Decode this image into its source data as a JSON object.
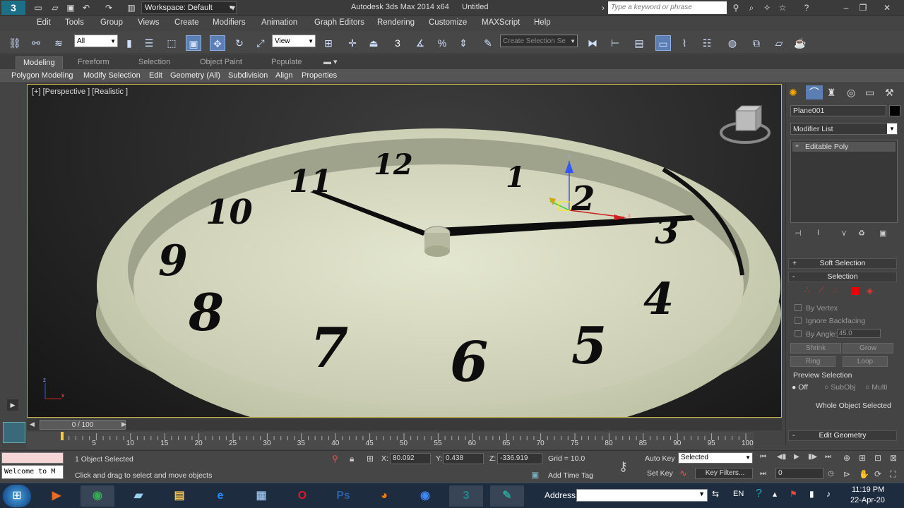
{
  "titlebar": {
    "app_icon_label": "3",
    "workspace": "Workspace: Default",
    "app_name": "Autodesk 3ds Max  2014 x64",
    "doc_name": "Untitled",
    "search_placeholder": "Type a keyword or phrase"
  },
  "menu": [
    "Edit",
    "Tools",
    "Group",
    "Views",
    "Create",
    "Modifiers",
    "Animation",
    "Graph Editors",
    "Rendering",
    "Customize",
    "MAXScript",
    "Help"
  ],
  "toolbar": {
    "selection_filter": "All",
    "ref_coord": "View",
    "named_selection": "Create Selection Se",
    "snap_label": "3"
  },
  "ribbon": {
    "tabs": [
      "Modeling",
      "Freeform",
      "Selection",
      "Object Paint",
      "Populate"
    ],
    "active_tab": "Modeling",
    "sub": [
      "Polygon Modeling",
      "Modify Selection",
      "Edit",
      "Geometry (All)",
      "Subdivision",
      "Align",
      "Properties"
    ]
  },
  "viewport": {
    "label": "[+] [Perspective ] [Realistic ]",
    "clock_numbers": [
      "12",
      "1",
      "2",
      "3",
      "4",
      "5",
      "6",
      "7",
      "8",
      "9",
      "10",
      "11"
    ],
    "gizmo": {
      "x": "x",
      "y": "y",
      "z": "z"
    }
  },
  "command_panel": {
    "object_name": "Plane001",
    "modifier_list": "Modifier List",
    "stack_item": "Editable Poly",
    "soft_selection": "Soft Selection",
    "selection": "Selection",
    "by_vertex": "By Vertex",
    "ignore_backfacing": "Ignore Backfacing",
    "by_angle": "By Angle:",
    "angle_value": "45.0",
    "shrink": "Shrink",
    "grow": "Grow",
    "ring": "Ring",
    "loop": "Loop",
    "preview_selection": "Preview Selection",
    "preview_options": [
      "Off",
      "SubObj",
      "Multi"
    ],
    "whole_object": "Whole Object Selected",
    "edit_geometry": "Edit Geometry",
    "rollout_plus": "+",
    "rollout_minus": "-"
  },
  "timeline": {
    "frame": "0 / 100",
    "ticks": [
      "5",
      "10",
      "15",
      "20",
      "25",
      "30",
      "35",
      "40",
      "45",
      "50",
      "55",
      "60",
      "65",
      "70",
      "75",
      "80",
      "85",
      "90",
      "95",
      "100"
    ]
  },
  "status": {
    "selected": "1 Object Selected",
    "hint": "Click and drag to select and move objects",
    "maxscript": "Welcome to M",
    "x_label": "X:",
    "x": "80.092",
    "y_label": "Y:",
    "y": "0.438",
    "z_label": "Z:",
    "z": "-336.919",
    "grid": "Grid = 10.0",
    "add_time_tag": "Add Time Tag",
    "auto_key": "Auto Key",
    "set_key": "Set Key",
    "key_mode": "Selected",
    "key_filters": "Key Filters...",
    "frame_field": "0"
  },
  "taskbar": {
    "address_label": "Address",
    "lang": "EN",
    "time": "11:19 PM",
    "date": "22-Apr-20",
    "apps": [
      {
        "name": "windows-media-icon",
        "glyph": "▶",
        "color": "#e86d1f"
      },
      {
        "name": "chrome-icon",
        "glyph": "◉",
        "color": "#3aa757"
      },
      {
        "name": "files-icon",
        "glyph": "▰",
        "color": "#9ad0ec"
      },
      {
        "name": "explorer-icon",
        "glyph": "▤",
        "color": "#f0c24a"
      },
      {
        "name": "ie-icon",
        "glyph": "e",
        "color": "#1e90ff"
      },
      {
        "name": "calculator-icon",
        "glyph": "▦",
        "color": "#8fb3d9"
      },
      {
        "name": "opera-icon",
        "glyph": "O",
        "color": "#e0182d"
      },
      {
        "name": "photoshop-icon",
        "glyph": "Ps",
        "color": "#2a5fa8"
      },
      {
        "name": "firefox-icon",
        "glyph": "◕",
        "color": "#ff7a00"
      },
      {
        "name": "chrome2-icon",
        "glyph": "◉",
        "color": "#4285f4"
      },
      {
        "name": "3dsmax-icon",
        "glyph": "3",
        "color": "#1a8c8c"
      },
      {
        "name": "app-icon",
        "glyph": "✎",
        "color": "#2aa198"
      }
    ]
  },
  "colors": {
    "accent": "#5b7fb3",
    "viewport_border": "#c5b54a",
    "clock_face": "#d8dcc0"
  }
}
